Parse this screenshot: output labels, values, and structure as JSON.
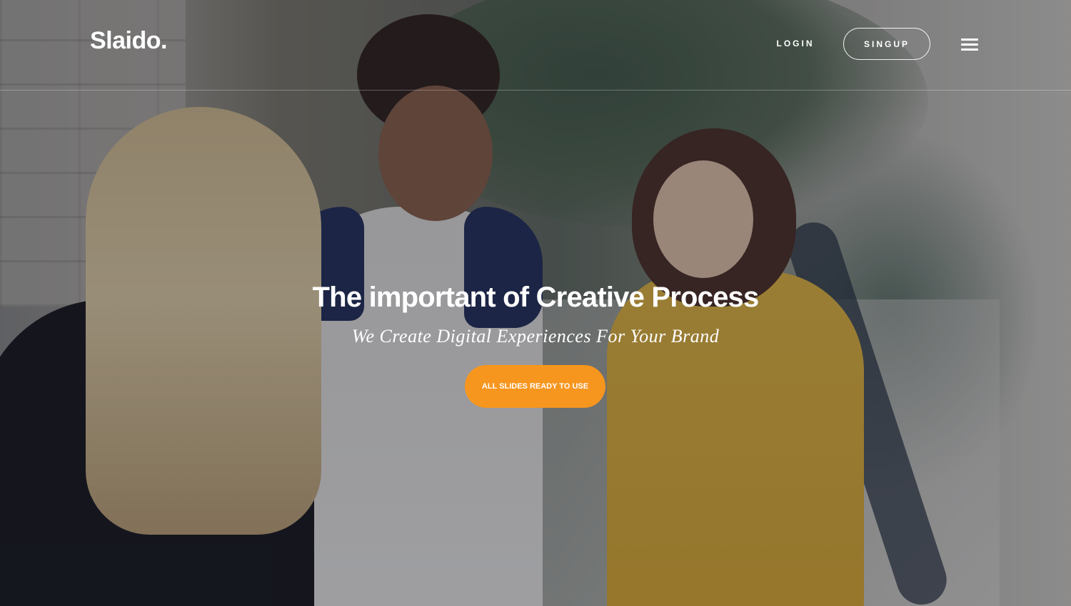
{
  "brand": {
    "logo_text": "Slaido."
  },
  "nav": {
    "login_label": "LOGIN",
    "signup_label": "SINGUP",
    "menu_icon": "hamburger-menu-icon"
  },
  "hero": {
    "title": "The important of Creative Process",
    "subtitle": "We Create Digital Experiences For Your Brand",
    "cta_label": "ALL SLIDES READY TO USE"
  },
  "colors": {
    "accent": "#f7961e",
    "text": "#ffffff"
  }
}
